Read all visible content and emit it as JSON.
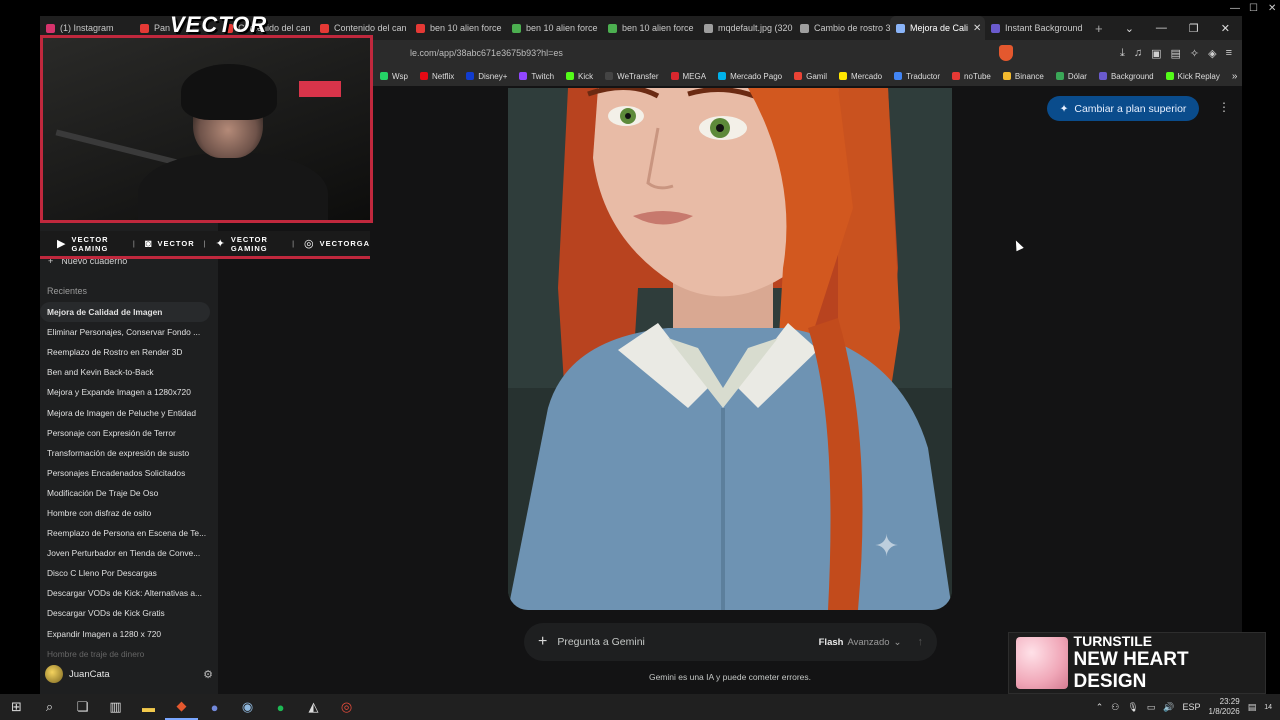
{
  "browser": {
    "tabs": [
      {
        "label": "(1) Instagram",
        "color": "#d6336c"
      },
      {
        "label": "Pan",
        "color": "#e53935"
      },
      {
        "label": "Contenido del can",
        "color": "#e53935"
      },
      {
        "label": "Contenido del can",
        "color": "#e53935"
      },
      {
        "label": "ben 10 alien force",
        "color": "#e53935"
      },
      {
        "label": "ben 10 alien force",
        "color": "#4caf50"
      },
      {
        "label": "ben 10 alien force",
        "color": "#4caf50"
      },
      {
        "label": "mqdefault.jpg (320",
        "color": "#9e9e9e"
      },
      {
        "label": "Cambio de rostro 3",
        "color": "#9e9e9e"
      },
      {
        "label": "Mejora de Cali",
        "color": "#8ab4f8"
      },
      {
        "label": "Instant Background",
        "color": "#6a5acd"
      }
    ],
    "url": "le.com/app/38abc671e3675b93?hl=es",
    "bookmarks": [
      {
        "label": "Wsp",
        "color": "#25d366"
      },
      {
        "label": "Netflix",
        "color": "#e50914"
      },
      {
        "label": "Disney+",
        "color": "#113ccf"
      },
      {
        "label": "Twitch",
        "color": "#9146ff"
      },
      {
        "label": "Kick",
        "color": "#53fc18"
      },
      {
        "label": "WeTransfer",
        "color": "#222222"
      },
      {
        "label": "MEGA",
        "color": "#d9272e"
      },
      {
        "label": "Mercado Pago",
        "color": "#00b1ea"
      },
      {
        "label": "Gamil",
        "color": "#ea4335"
      },
      {
        "label": "Mercado",
        "color": "#ffe600"
      },
      {
        "label": "Traductor",
        "color": "#4285f4"
      },
      {
        "label": "noTube",
        "color": "#e53935"
      },
      {
        "label": "Binance",
        "color": "#f3ba2f"
      },
      {
        "label": "Dólar",
        "color": "#3aa757"
      },
      {
        "label": "Background",
        "color": "#6a5acd"
      },
      {
        "label": "Kick Replay",
        "color": "#53fc18"
      }
    ]
  },
  "sidebar": {
    "new_notebook": "Nuevo cuaderno",
    "recent_label": "Recientes",
    "items": [
      "Mejora de Calidad de Imagen",
      "Eliminar Personajes, Conservar Fondo ...",
      "Reemplazo de Rostro en Render 3D",
      "Ben and Kevin Back-to-Back",
      "Mejora y Expande Imagen a 1280x720",
      "Mejora de Imagen de Peluche y Entidad",
      "Personaje con Expresión de Terror",
      "Transformación de expresión de susto",
      "Personajes Encadenados Solicitados",
      "Modificación De Traje De Oso",
      "Hombre con disfraz de osito",
      "Reemplazo de Persona en Escena de Te...",
      "Joven Perturbador en Tienda de Conve...",
      "Disco C Lleno Por Descargas",
      "Descargar VODs de Kick: Alternativas a...",
      "Descargar VODs de Kick Gratis",
      "Expandir Imagen a 1280 x 720",
      "Hombre de traje de dinero"
    ],
    "user_name": "JuanCata"
  },
  "main": {
    "upgrade_label": "Cambiar a plan superior",
    "prompt_placeholder": "Pregunta a Gemini",
    "model_name": "Flash",
    "model_mode": "Avanzado",
    "disclaimer": "Gemini es una IA y puede cometer errores."
  },
  "overlay": {
    "streamer_name": "VECTOR",
    "socials": [
      {
        "icon": "youtube-icon",
        "glyph": "▶",
        "label": "VECTOR GAMING"
      },
      {
        "icon": "twitch-icon",
        "glyph": "◙",
        "label": "VECTOR"
      },
      {
        "icon": "twitter-icon",
        "glyph": "✦",
        "label": "VECTOR GAMING"
      },
      {
        "icon": "instagram-icon",
        "glyph": "◎",
        "label": "VECTORGA"
      }
    ],
    "now_playing_artist": "TURNSTILE",
    "now_playing_track": "NEW HEART DESIGN"
  },
  "taskbar": {
    "language": "ESP",
    "time": "23:29",
    "date": "1/8/2026",
    "notifications": "14"
  }
}
